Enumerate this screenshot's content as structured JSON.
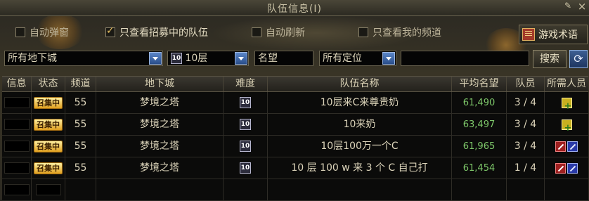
{
  "window": {
    "title": "队伍信息(I)"
  },
  "filters_row1": {
    "auto_popup": {
      "label": "自动弹窗",
      "checked": false
    },
    "only_recruiting": {
      "label": "只查看招募中的队伍",
      "checked": true
    },
    "auto_refresh": {
      "label": "自动刷新",
      "checked": false
    },
    "only_my_channel": {
      "label": "只查看我的频道",
      "checked": false
    },
    "game_terms_label": "游戏术语"
  },
  "filters_row2": {
    "dungeon_select": "所有地下城",
    "floor_badge": "10",
    "floor_select": "10层",
    "fame_label": "名望",
    "position_select": "所有定位",
    "search_value": "",
    "search_label": "搜索"
  },
  "table": {
    "headers": [
      "信息",
      "状态",
      "频道",
      "地下城",
      "难度",
      "队伍名称",
      "平均名望",
      "队员",
      "所需人员"
    ],
    "rows": [
      {
        "status": "召集中",
        "channel": "55",
        "dungeon": "梦境之塔",
        "difficulty": "10",
        "team_name": "10层来C来尊贵奶",
        "avg_fame": "61,490",
        "members": "3 / 4",
        "needs": [
          "heal"
        ]
      },
      {
        "status": "召集中",
        "channel": "55",
        "dungeon": "梦境之塔",
        "difficulty": "10",
        "team_name": "10来奶",
        "avg_fame": "63,497",
        "members": "3 / 4",
        "needs": [
          "heal"
        ]
      },
      {
        "status": "召集中",
        "channel": "55",
        "dungeon": "梦境之塔",
        "difficulty": "10",
        "team_name": "10层100万一个C",
        "avg_fame": "61,965",
        "members": "3 / 4",
        "needs": [
          "atk",
          "mag"
        ]
      },
      {
        "status": "召集中",
        "channel": "55",
        "dungeon": "梦境之塔",
        "difficulty": "10",
        "team_name": "10 层 100 w 来 3 个 C 自己打",
        "avg_fame": "61,454",
        "members": "1 / 4",
        "needs": [
          "atk",
          "mag"
        ]
      }
    ]
  },
  "colors": {
    "fame_green": "#7ec86a",
    "recruit_gold": "#e0a020",
    "panel_bg": "#2a2822"
  },
  "icons": {
    "pin": "pin-icon",
    "close": "close-icon",
    "book": "book-icon",
    "refresh": "refresh-icon",
    "dropdown": "chevron-down-icon",
    "healer": "healer-role-icon",
    "physical": "physical-attacker-role-icon",
    "magic": "magic-attacker-role-icon"
  }
}
